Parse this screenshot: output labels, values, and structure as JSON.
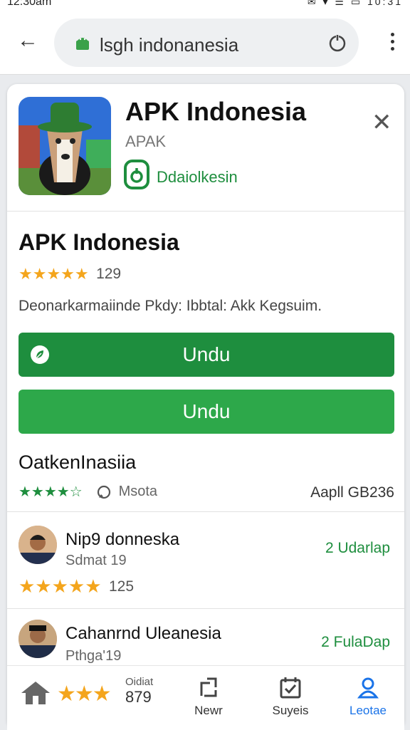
{
  "status_bar": {
    "time": "12:30am",
    "right": "✉ ▾ ☰ ▭ 10:31"
  },
  "browser": {
    "url": "lsgh indonanesia"
  },
  "app": {
    "title": "APK Indonesia",
    "subtitle": "APAK",
    "download_text": "Ddaiolkesin"
  },
  "section": {
    "title": "APK Indonesia",
    "stars": "★★★★★",
    "rating_count": "129",
    "description": "Deonarkarmaiinde Pkdy: Ibbtal: Akk Kegsuim."
  },
  "buttons": {
    "primary": "Undu",
    "secondary": "Undu"
  },
  "list": {
    "title": "OatkenInasiia",
    "stars": "★★★★☆",
    "meta": "Msota",
    "right": "Aapll GB236"
  },
  "reviews": [
    {
      "name": "Nip9 donneska",
      "sub": "Sdmat 19",
      "action": "2 Udarlap",
      "stars": "★★★★★",
      "count": "125"
    },
    {
      "name": "Cahanrnd Uleanesia",
      "sub": "Pthga'19",
      "action": "2 FulaDap"
    }
  ],
  "nav": {
    "home_small": "Oidiat",
    "home_num": "879",
    "news": "Newr",
    "surveys": "Suyeis",
    "profile": "Leotae"
  },
  "colors": {
    "accent": "#1e8e3e",
    "star": "#f4a51c",
    "profile": "#1a73e8"
  }
}
